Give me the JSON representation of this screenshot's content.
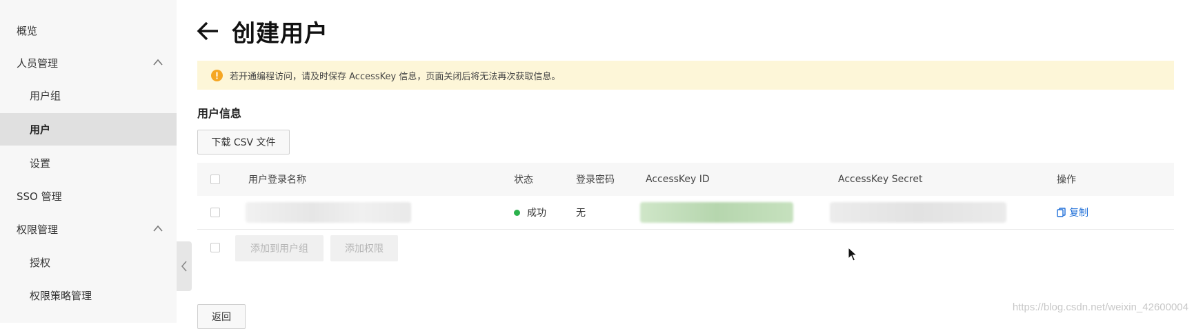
{
  "sidebar": {
    "items": [
      {
        "label": "概览"
      },
      {
        "label": "人员管理"
      },
      {
        "label": "用户组"
      },
      {
        "label": "用户"
      },
      {
        "label": "设置"
      },
      {
        "label": "SSO 管理"
      },
      {
        "label": "权限管理"
      },
      {
        "label": "授权"
      },
      {
        "label": "权限策略管理"
      }
    ]
  },
  "header": {
    "title": "创建用户"
  },
  "notice": {
    "text": "若开通编程访问，请及时保存 AccessKey 信息，页面关闭后将无法再次获取信息。"
  },
  "section": {
    "title": "用户信息",
    "download_label": "下载 CSV 文件"
  },
  "table": {
    "columns": [
      "用户登录名称",
      "状态",
      "登录密码",
      "AccessKey ID",
      "AccessKey Secret",
      "操作"
    ],
    "rows": [
      {
        "status": "成功",
        "password": "无",
        "action": "复制"
      }
    ],
    "footer_buttons": [
      "添加到用户组",
      "添加权限"
    ]
  },
  "back_label": "返回",
  "watermark": "https://blog.csdn.net/weixin_42600004",
  "colors": {
    "notice_bg": "#fdf6d8",
    "notice_icon": "#f5a623",
    "status_success": "#2bb24c",
    "link": "#1f6fd8",
    "sidebar_active": "#e0e0e0"
  }
}
